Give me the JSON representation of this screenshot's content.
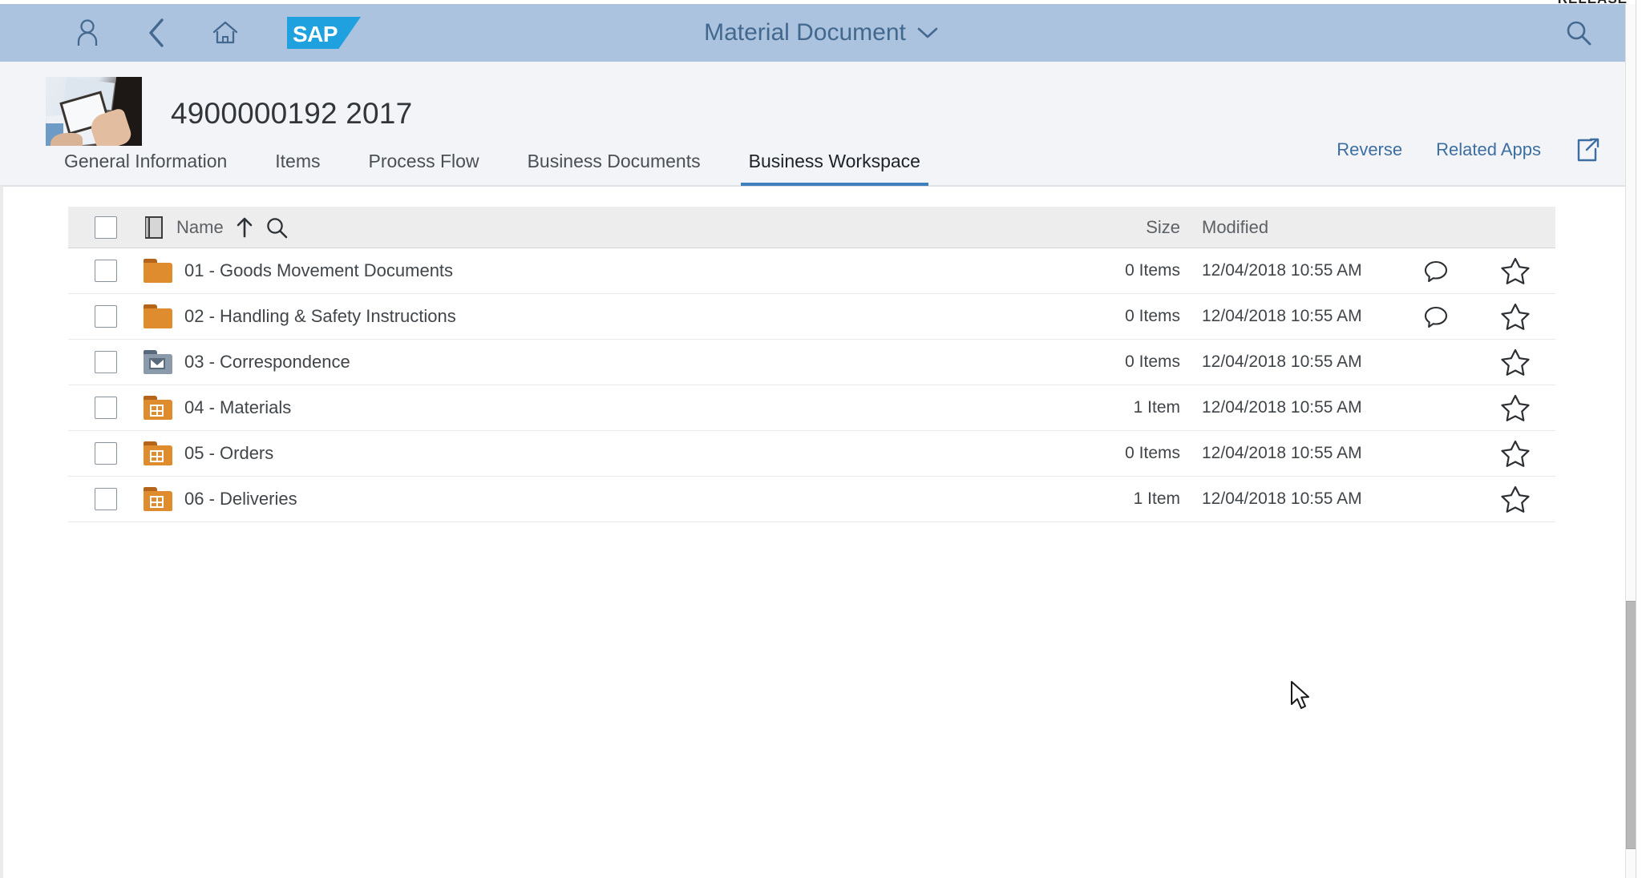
{
  "cutoff": {
    "text": "RELEASE"
  },
  "shellbar": {
    "user_icon": "user-icon",
    "back_icon": "back-chevron-icon",
    "home_icon": "home-icon",
    "logo_text": "SAP",
    "title": "Material Document",
    "title_chevron": "chevron-down-icon",
    "search_icon": "search-icon",
    "bg_color": "#abc3de",
    "logo_color": "#1fa1e0",
    "title_color": "#43688e"
  },
  "object_header": {
    "title": "4900000192 2017",
    "thumbnail": "document-photo-thumbnail",
    "actions": [
      {
        "label": "Reverse",
        "name": "reverse-button"
      },
      {
        "label": "Related Apps",
        "name": "related-apps-button"
      }
    ],
    "share_icon": "share-export-icon",
    "link_color": "#3d6ea1"
  },
  "tabs": [
    {
      "label": "General Information",
      "active": false
    },
    {
      "label": "Items",
      "active": false
    },
    {
      "label": "Process Flow",
      "active": false
    },
    {
      "label": "Business Documents",
      "active": false
    },
    {
      "label": "Business Workspace",
      "active": true
    }
  ],
  "table": {
    "header": {
      "file_icon": "document-column-icon",
      "name": "Name",
      "sort_icon": "sort-ascending-arrow-icon",
      "search_icon": "search-icon",
      "size": "Size",
      "modified": "Modified"
    },
    "rows": [
      {
        "name": "01 - Goods Movement Documents",
        "size": "0 Items",
        "modified": "12/04/2018 10:55 AM",
        "icon": "folder-orange-icon",
        "icon_kind": "plain",
        "has_comment": true,
        "has_favorite": true
      },
      {
        "name": "02 - Handling & Safety Instructions",
        "size": "0 Items",
        "modified": "12/04/2018 10:55 AM",
        "icon": "folder-orange-icon",
        "icon_kind": "plain",
        "has_comment": true,
        "has_favorite": true
      },
      {
        "name": "03 - Correspondence",
        "size": "0 Items",
        "modified": "12/04/2018 10:55 AM",
        "icon": "folder-mail-icon",
        "icon_kind": "mail",
        "has_comment": false,
        "has_favorite": true
      },
      {
        "name": "04 - Materials",
        "size": "1 Item",
        "modified": "12/04/2018 10:55 AM",
        "icon": "folder-grid-icon",
        "icon_kind": "grid",
        "has_comment": false,
        "has_favorite": true
      },
      {
        "name": "05 - Orders",
        "size": "0 Items",
        "modified": "12/04/2018 10:55 AM",
        "icon": "folder-grid-icon",
        "icon_kind": "grid",
        "has_comment": false,
        "has_favorite": true
      },
      {
        "name": "06 - Deliveries",
        "size": "1 Item",
        "modified": "12/04/2018 10:55 AM",
        "icon": "folder-grid-icon",
        "icon_kind": "grid",
        "has_comment": false,
        "has_favorite": true
      }
    ]
  },
  "colors": {
    "folder_orange": "#df8c2e",
    "folder_gray": "#8a9aab",
    "tab_active_underline": "#3f7fbb",
    "header_row_bg": "#ededed"
  }
}
